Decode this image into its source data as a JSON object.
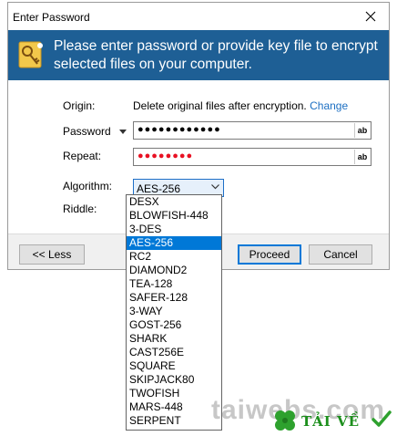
{
  "window": {
    "title": "Enter Password"
  },
  "banner": {
    "text": "Please enter password or provide key file to encrypt selected files on your computer."
  },
  "form": {
    "origin_label": "Origin:",
    "origin_text": "Delete original files after encryption.",
    "origin_link": "Change",
    "password_label": "Password",
    "password_mask": "●●●●●●●●●●●●",
    "repeat_label": "Repeat:",
    "repeat_mask": "●●●●●●●●",
    "ab_label": "ab",
    "algorithm_label": "Algorithm:",
    "riddle_label": "Riddle:",
    "algorithm_selected": "AES-256"
  },
  "buttons": {
    "less": "<< Less",
    "proceed": "Proceed",
    "cancel": "Cancel"
  },
  "algorithms": [
    "DESX",
    "BLOWFISH-448",
    "3-DES",
    "AES-256",
    "RC2",
    "DIAMOND2",
    "TEA-128",
    "SAFER-128",
    "3-WAY",
    "GOST-256",
    "SHARK",
    "CAST256E",
    "SQUARE",
    "SKIPJACK80",
    "TWOFISH",
    "MARS-448",
    "SERPENT"
  ],
  "watermark": {
    "site": "taiwebs.com",
    "brand": "TẢI VỀ"
  },
  "colors": {
    "banner": "#1e5f95",
    "accent": "#0078d7",
    "link": "#1c6fc2",
    "repeat_mask": "#e81123"
  }
}
